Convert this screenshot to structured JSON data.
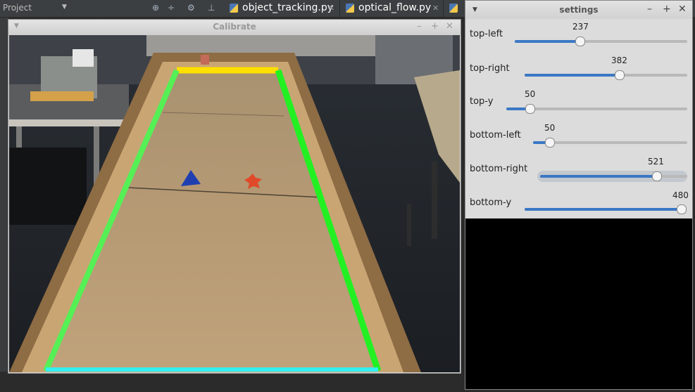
{
  "ide": {
    "project_label": "Project",
    "tabs": [
      {
        "label": "object_tracking.py"
      },
      {
        "label": "optical_flow.py"
      }
    ],
    "toolbar_icons": [
      "target-icon",
      "split-icon",
      "gear-icon",
      "pin-icon"
    ]
  },
  "calibrate": {
    "title": "Calibrate",
    "camera": {
      "description_colors": {
        "top_line": "#ffe000",
        "side_lines": "#33ff33",
        "bottom_line": "#33f0f0"
      }
    }
  },
  "settings": {
    "title": "settings",
    "trackbars": [
      {
        "name": "top-left",
        "value": "237",
        "level": 0.29
      },
      {
        "name": "top-right",
        "value": "382",
        "level": 0.63
      },
      {
        "name": "top-y",
        "value": "50",
        "level": 0.13
      },
      {
        "name": "bottom-left",
        "value": "50",
        "level": 0.1
      },
      {
        "name": "bottom-right",
        "value": "521",
        "level": 0.81
      },
      {
        "name": "bottom-y",
        "value": "480",
        "level": 1.0
      }
    ]
  }
}
